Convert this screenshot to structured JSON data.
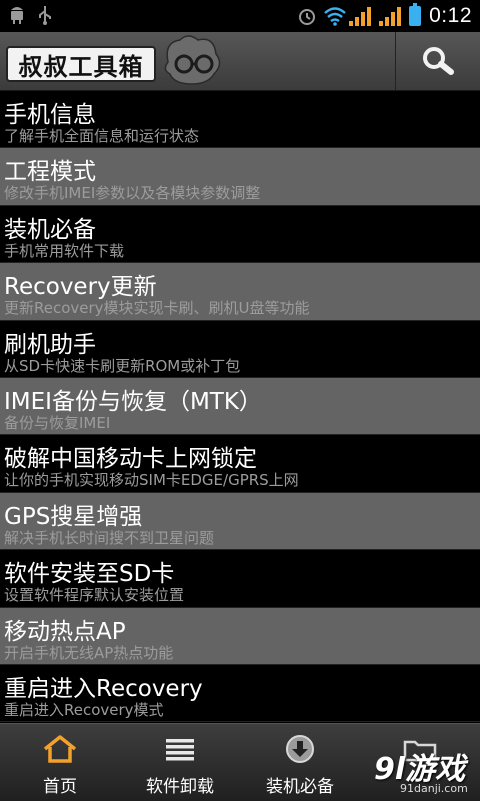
{
  "status_bar": {
    "time": "0:12",
    "icons": [
      "android-icon",
      "usb-icon",
      "alarm-icon",
      "wifi-icon",
      "signal-icon",
      "signal-icon-2",
      "battery-charging-icon"
    ]
  },
  "header": {
    "logo_text": "叔叔工具箱"
  },
  "list": {
    "items": [
      {
        "title": "手机信息",
        "subtitle": "了解手机全面信息和运行状态"
      },
      {
        "title": "工程模式",
        "subtitle": "修改手机IMEI参数以及各模块参数调整"
      },
      {
        "title": "装机必备",
        "subtitle": "手机常用软件下载"
      },
      {
        "title": "Recovery更新",
        "subtitle": "更新Recovery模块实现卡刷、刷机U盘等功能"
      },
      {
        "title": "刷机助手",
        "subtitle": "从SD卡快速卡刷更新ROM或补丁包"
      },
      {
        "title": "IMEI备份与恢复（MTK）",
        "subtitle": "备份与恢复IMEI"
      },
      {
        "title": "破解中国移动卡上网锁定",
        "subtitle": "让你的手机实现移动SIM卡EDGE/GPRS上网"
      },
      {
        "title": "GPS搜星增强",
        "subtitle": "解决手机长时间搜不到卫星问题"
      },
      {
        "title": "软件安装至SD卡",
        "subtitle": "设置软件程序默认安装位置"
      },
      {
        "title": "移动热点AP",
        "subtitle": "开启手机无线AP热点功能"
      },
      {
        "title": "重启进入Recovery",
        "subtitle": "重启进入Recovery模式"
      }
    ]
  },
  "tabbar": {
    "tabs": [
      {
        "label": "首页",
        "icon": "home-icon"
      },
      {
        "label": "软件卸载",
        "icon": "list-icon"
      },
      {
        "label": "装机必备",
        "icon": "download-icon"
      },
      {
        "label": "",
        "icon": "folder-icon"
      }
    ]
  },
  "watermark": {
    "main": "9l游戏",
    "sub": "91danji.com"
  },
  "colors": {
    "accent": "#f4a12b",
    "item_gray": "#646464",
    "item_black": "#000000",
    "subtitle": "#9c9c9c"
  }
}
